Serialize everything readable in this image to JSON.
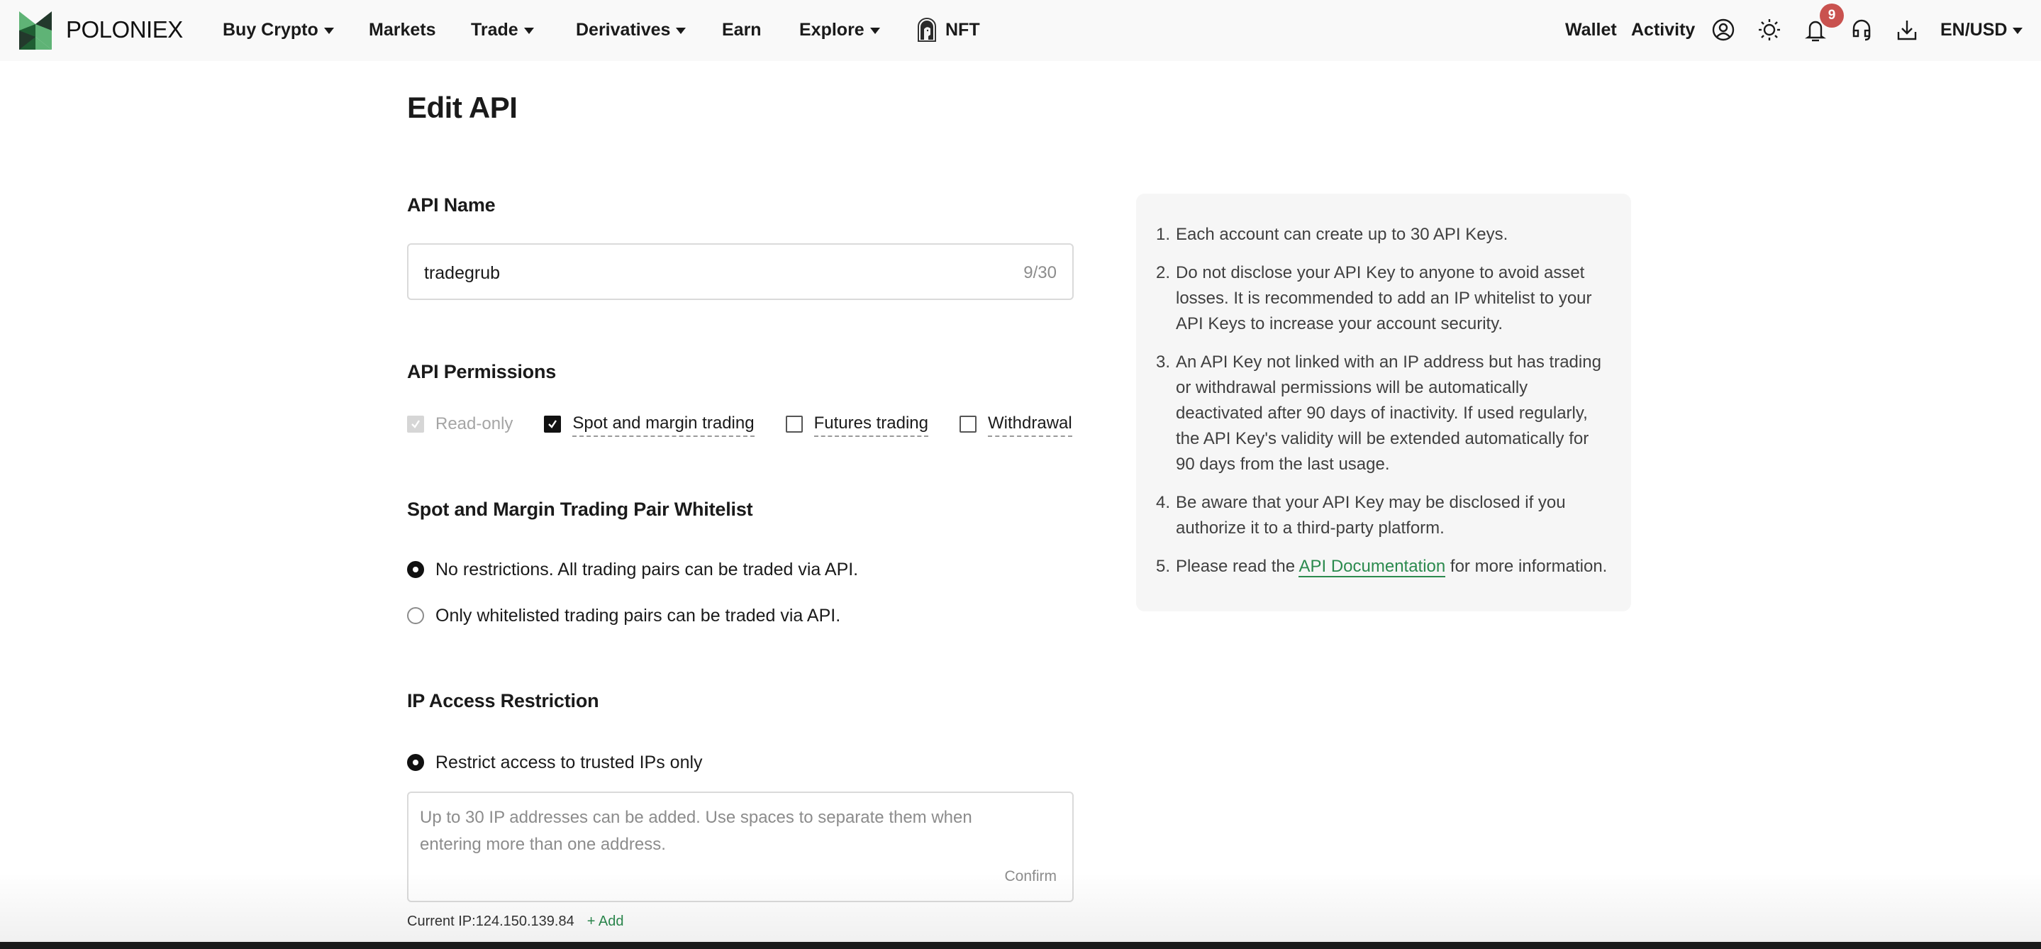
{
  "nav": {
    "brand": "POLONIEX",
    "items": [
      {
        "label": "Buy Crypto",
        "has_dropdown": true
      },
      {
        "label": "Markets",
        "has_dropdown": false
      },
      {
        "label": "Trade",
        "has_dropdown": true
      },
      {
        "label": "Derivatives",
        "has_dropdown": true
      },
      {
        "label": "Earn",
        "has_dropdown": false
      },
      {
        "label": "Explore",
        "has_dropdown": true
      },
      {
        "label": "NFT",
        "has_dropdown": false,
        "icon": "nft-icon"
      }
    ],
    "right": {
      "wallet": "Wallet",
      "activity": "Activity",
      "icons": [
        "user-icon",
        "sun-icon",
        "bell-icon",
        "headset-icon",
        "download-icon"
      ],
      "notification_count": "9",
      "locale": "EN/USD"
    }
  },
  "page": {
    "title": "Edit API"
  },
  "api_name": {
    "label": "API Name",
    "value": "tradegrub",
    "counter": "9/30"
  },
  "permissions": {
    "label": "API Permissions",
    "options": [
      {
        "label": "Read-only",
        "checked": true,
        "disabled": true
      },
      {
        "label": "Spot and margin trading",
        "checked": true,
        "disabled": false
      },
      {
        "label": "Futures trading",
        "checked": false,
        "disabled": false
      },
      {
        "label": "Withdrawal",
        "checked": false,
        "disabled": false
      }
    ]
  },
  "whitelist": {
    "label": "Spot and Margin Trading Pair Whitelist",
    "options": [
      {
        "label": "No restrictions. All trading pairs can be traded via API.",
        "selected": true
      },
      {
        "label": "Only whitelisted trading pairs can be traded via API.",
        "selected": false
      }
    ]
  },
  "ip_restriction": {
    "label": "IP Access Restriction",
    "option": {
      "label": "Restrict access to trusted IPs only",
      "selected": true
    },
    "placeholder": "Up to 30 IP addresses can be added. Use spaces to separate them when entering more than one address.",
    "confirm": "Confirm",
    "current_ip_label": "Current IP:124.150.139.84",
    "add_label": "+ Add"
  },
  "info": {
    "items": [
      {
        "num": "1.",
        "text": "Each account can create up to 30 API Keys."
      },
      {
        "num": "2.",
        "text": "Do not disclose your API Key to anyone to avoid asset losses. It is recommended to add an IP whitelist to your API Keys to increase your account security."
      },
      {
        "num": "3.",
        "text": "An API Key not linked with an IP address but has trading or withdrawal permissions will be automatically deactivated after 90 days of inactivity. If used regularly, the API Key's validity will be extended automatically for 90 days from the last usage."
      },
      {
        "num": "4.",
        "text": "Be aware that your API Key may be disclosed if you authorize it to a third-party platform."
      }
    ],
    "last": {
      "num": "5.",
      "prefix": "Please read the ",
      "link": "API Documentation",
      "suffix": " for more information."
    }
  },
  "colors": {
    "accent_green": "#2b8a4e",
    "badge_red": "#c9524f",
    "nav_bg": "#f9f9f9",
    "panel_bg": "#f6f6f6"
  }
}
